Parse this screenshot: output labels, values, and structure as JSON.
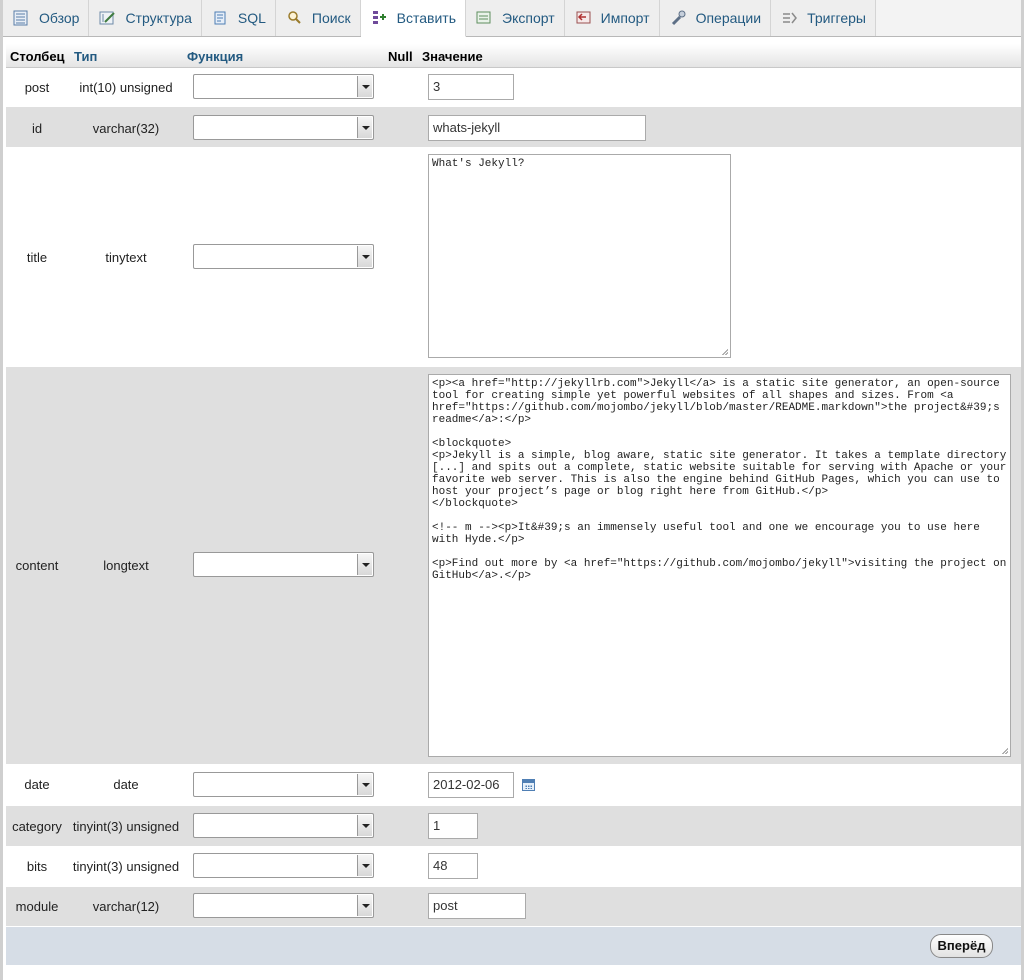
{
  "tabs": [
    {
      "label": "Обзор",
      "icon": "browse-icon"
    },
    {
      "label": "Структура",
      "icon": "structure-icon"
    },
    {
      "label": "SQL",
      "icon": "sql-icon"
    },
    {
      "label": "Поиск",
      "icon": "search-icon"
    },
    {
      "label": "Вставить",
      "icon": "insert-icon",
      "active": true
    },
    {
      "label": "Экспорт",
      "icon": "export-icon"
    },
    {
      "label": "Импорт",
      "icon": "import-icon"
    },
    {
      "label": "Операции",
      "icon": "wrench-icon"
    },
    {
      "label": "Триггеры",
      "icon": "triggers-icon"
    }
  ],
  "table": {
    "headers": {
      "column": "Столбец",
      "type": "Тип",
      "function": "Функция",
      "null": "Null",
      "value": "Значение"
    },
    "rows": [
      {
        "name": "post",
        "type": "int(10) unsigned",
        "function": "",
        "value": "3"
      },
      {
        "name": "id",
        "type": "varchar(32)",
        "function": "",
        "value": "whats-jekyll"
      },
      {
        "name": "title",
        "type": "tinytext",
        "function": "",
        "value": "What's Jekyll?"
      },
      {
        "name": "content",
        "type": "longtext",
        "function": "",
        "value": "<p><a href=\"http://jekyllrb.com\">Jekyll</a> is a static site generator, an open-source tool for creating simple yet powerful websites of all shapes and sizes. From <a href=\"https://github.com/mojombo/jekyll/blob/master/README.markdown\">the project&#39;s readme</a>:</p>\n\n<blockquote>\n<p>Jekyll is a simple, blog aware, static site generator. It takes a template directory [...] and spits out a complete, static website suitable for serving with Apache or your favorite web server. This is also the engine behind GitHub Pages, which you can use to host your project’s page or blog right here from GitHub.</p>\n</blockquote>\n\n<!-- m --><p>It&#39;s an immensely useful tool and one we encourage you to use here with Hyde.</p>\n\n<p>Find out more by <a href=\"https://github.com/mojombo/jekyll\">visiting the project on GitHub</a>.</p>"
      },
      {
        "name": "date",
        "type": "date",
        "function": "",
        "value": "2012-02-06",
        "calendar_icon": "calendar-icon"
      },
      {
        "name": "category",
        "type": "tinyint(3) unsigned",
        "function": "",
        "value": "1"
      },
      {
        "name": "bits",
        "type": "tinyint(3) unsigned",
        "function": "",
        "value": "48"
      },
      {
        "name": "module",
        "type": "varchar(12)",
        "function": "",
        "value": "post"
      }
    ]
  },
  "footer": {
    "go_label": "Вперёд"
  }
}
